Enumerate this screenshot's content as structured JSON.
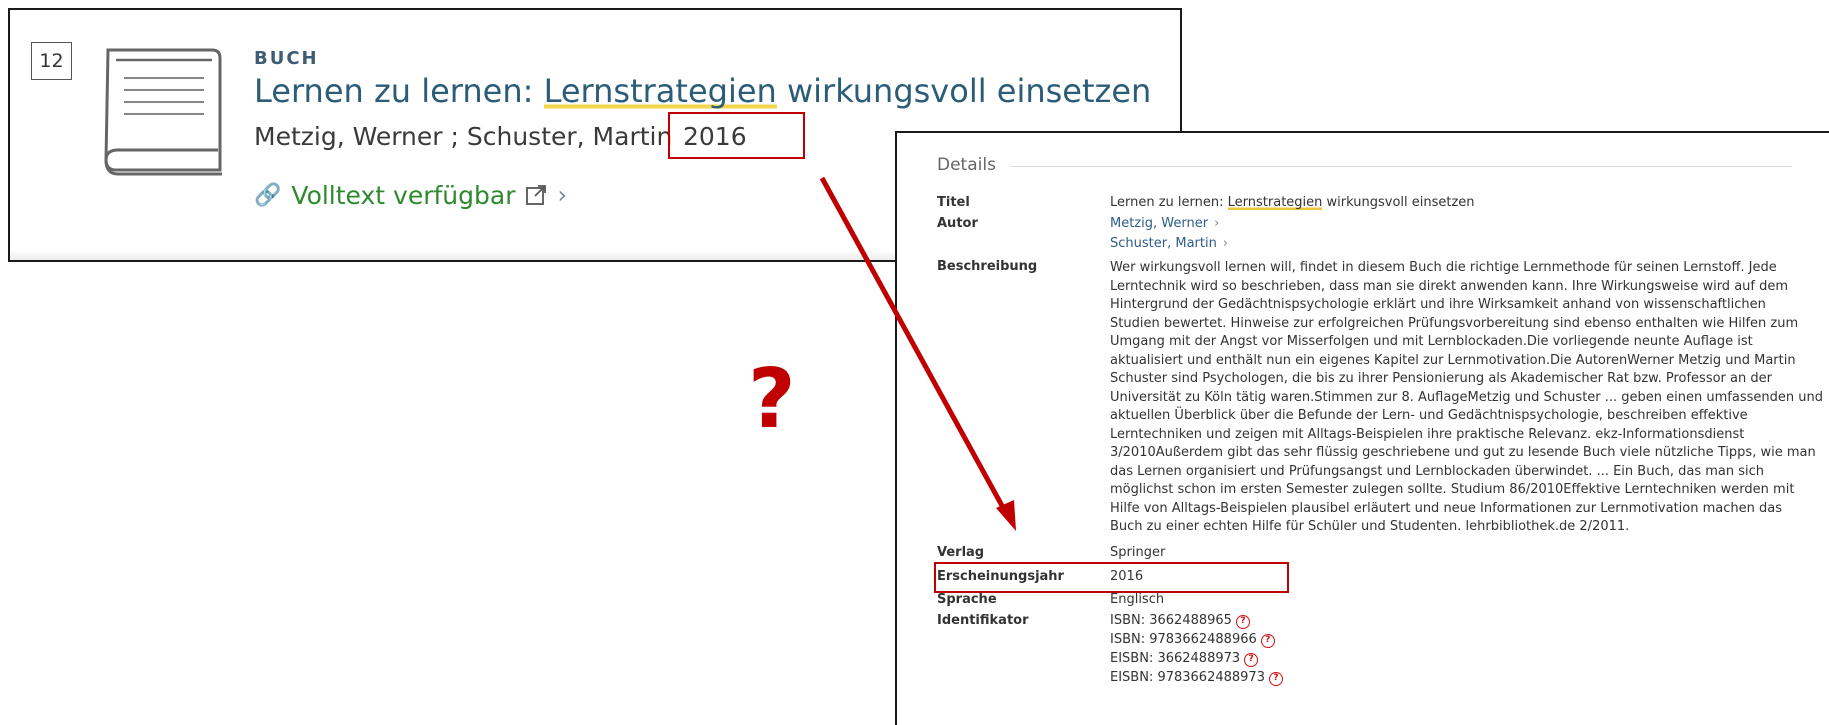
{
  "result": {
    "number": "12",
    "type": "BUCH",
    "title_part1": "Lernen zu lernen: ",
    "title_highlight": "Lernstrategien",
    "title_part2": " wirkungsvoll einsetzen",
    "authors": "Metzig, Werner ; Schuster, Martin",
    "year": "2016",
    "fulltext": "Volltext verfügbar",
    "icons": {
      "book": "book-icon",
      "link": "link-icon",
      "external": "external-link-icon",
      "chevron": "chevron-right-icon"
    }
  },
  "annotation": {
    "question_mark": "?",
    "color": "#c00000"
  },
  "details": {
    "heading": "Details",
    "title_label": "Titel",
    "title_part1": "Lernen zu lernen: ",
    "title_highlight": "Lernstrategien",
    "title_part2": " wirkungsvoll einsetzen",
    "author_label": "Autor",
    "authors": [
      "Metzig, Werner",
      "Schuster, Martin"
    ],
    "description_label": "Beschreibung",
    "description_lines": [
      "Wer wirkungsvoll lernen will, findet in diesem Buch die richtige Lernmethode für seinen Lernstoff. Jede",
      "Lerntechnik wird so beschrieben, dass man sie direkt anwenden kann. Ihre Wirkungsweise wird auf dem",
      "Hintergrund der Gedächtnispsychologie erklärt und ihre Wirksamkeit anhand von wissenschaftlichen",
      "Studien bewertet. Hinweise zur erfolgreichen Prüfungsvorbereitung sind ebenso enthalten wie Hilfen zum",
      "Umgang mit der Angst vor Misserfolgen und mit Lernblockaden.Die vorliegende neunte Auflage ist",
      "aktualisiert und enthält nun ein eigenes Kapitel zur Lernmotivation.Die AutorenWerner Metzig und Martin",
      "Schuster sind Psychologen, die bis zu ihrer Pensionierung als Akademischer Rat bzw. Professor an der",
      "Universität zu Köln tätig waren.Stimmen zur 8. AuflageMetzig und Schuster ... geben einen umfassenden und",
      "aktuellen Überblick über die Befunde der Lern- und Gedächtnispsychologie, beschreiben effektive",
      "Lerntechniken und zeigen mit Alltags-Beispielen ihre praktische Relevanz. ekz-Informationsdienst",
      "3/2010Außerdem gibt das sehr flüssig geschriebene und gut zu lesende Buch viele nützliche Tipps, wie man",
      "das Lernen organisiert und Prüfungsangst und Lernblockaden überwindet. ... Ein Buch, das man sich",
      "möglichst schon im ersten Semester zulegen sollte. Studium 86/2010Effektive Lerntechniken werden mit",
      "Hilfe von Alltags-Beispielen plausibel erläutert und neue Informationen zur Lernmotivation machen das",
      "Buch zu einer echten Hilfe für Schüler und Studenten. lehrbibliothek.de 2/2011."
    ],
    "publisher_label": "Verlag",
    "publisher": "Springer",
    "year_label": "Erscheinungsjahr",
    "year": "2016",
    "language_label": "Sprache",
    "language": "Englisch",
    "identifier_label": "Identifikator",
    "identifiers": [
      "ISBN: 3662488965",
      "ISBN: 9783662488966",
      "EISBN: 3662488973",
      "EISBN: 9783662488973"
    ],
    "info_icon_glyph": "?"
  }
}
